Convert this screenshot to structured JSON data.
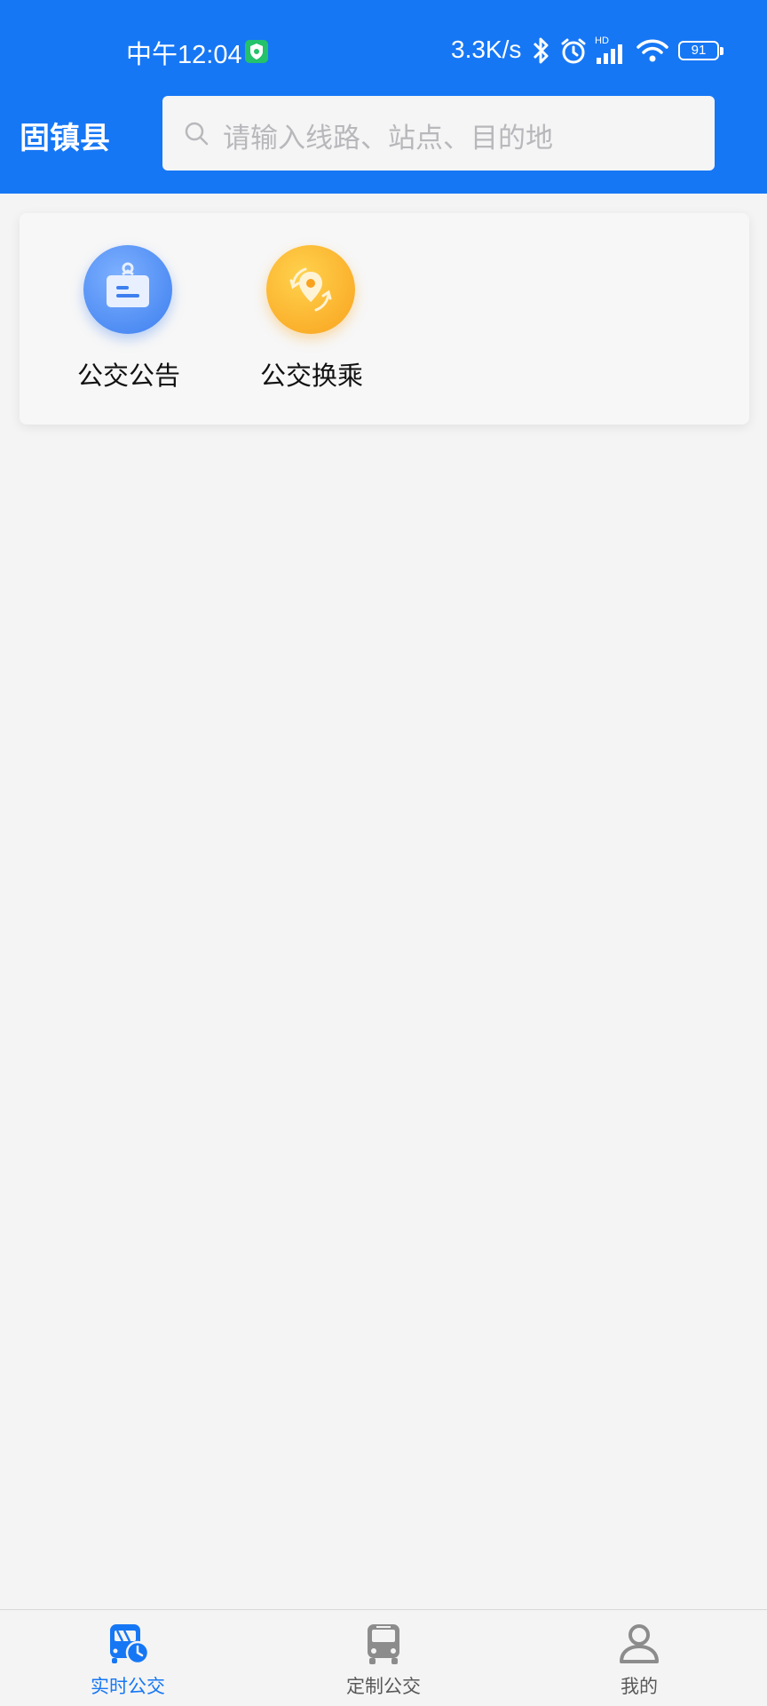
{
  "status_bar": {
    "time": "中午12:04",
    "net_speed": "3.3K/s",
    "signal_label": "HD",
    "battery": "91"
  },
  "header": {
    "city": "固镇县",
    "search_placeholder": "请输入线路、站点、目的地"
  },
  "quick_actions": [
    {
      "label": "公交公告",
      "icon": "notice-board-icon"
    },
    {
      "label": "公交换乘",
      "icon": "transfer-location-icon"
    }
  ],
  "bottom_nav": {
    "items": [
      {
        "label": "实时公交",
        "icon": "realtime-bus-icon",
        "active": true
      },
      {
        "label": "定制公交",
        "icon": "bus-icon",
        "active": false
      },
      {
        "label": "我的",
        "icon": "user-icon",
        "active": false
      }
    ],
    "active_color": "#1677f5",
    "inactive_color": "#8c8c8c"
  },
  "colors": {
    "primary": "#1677f5",
    "notice_icon": "#3d7fef",
    "transfer_icon": "#f9a21e"
  }
}
